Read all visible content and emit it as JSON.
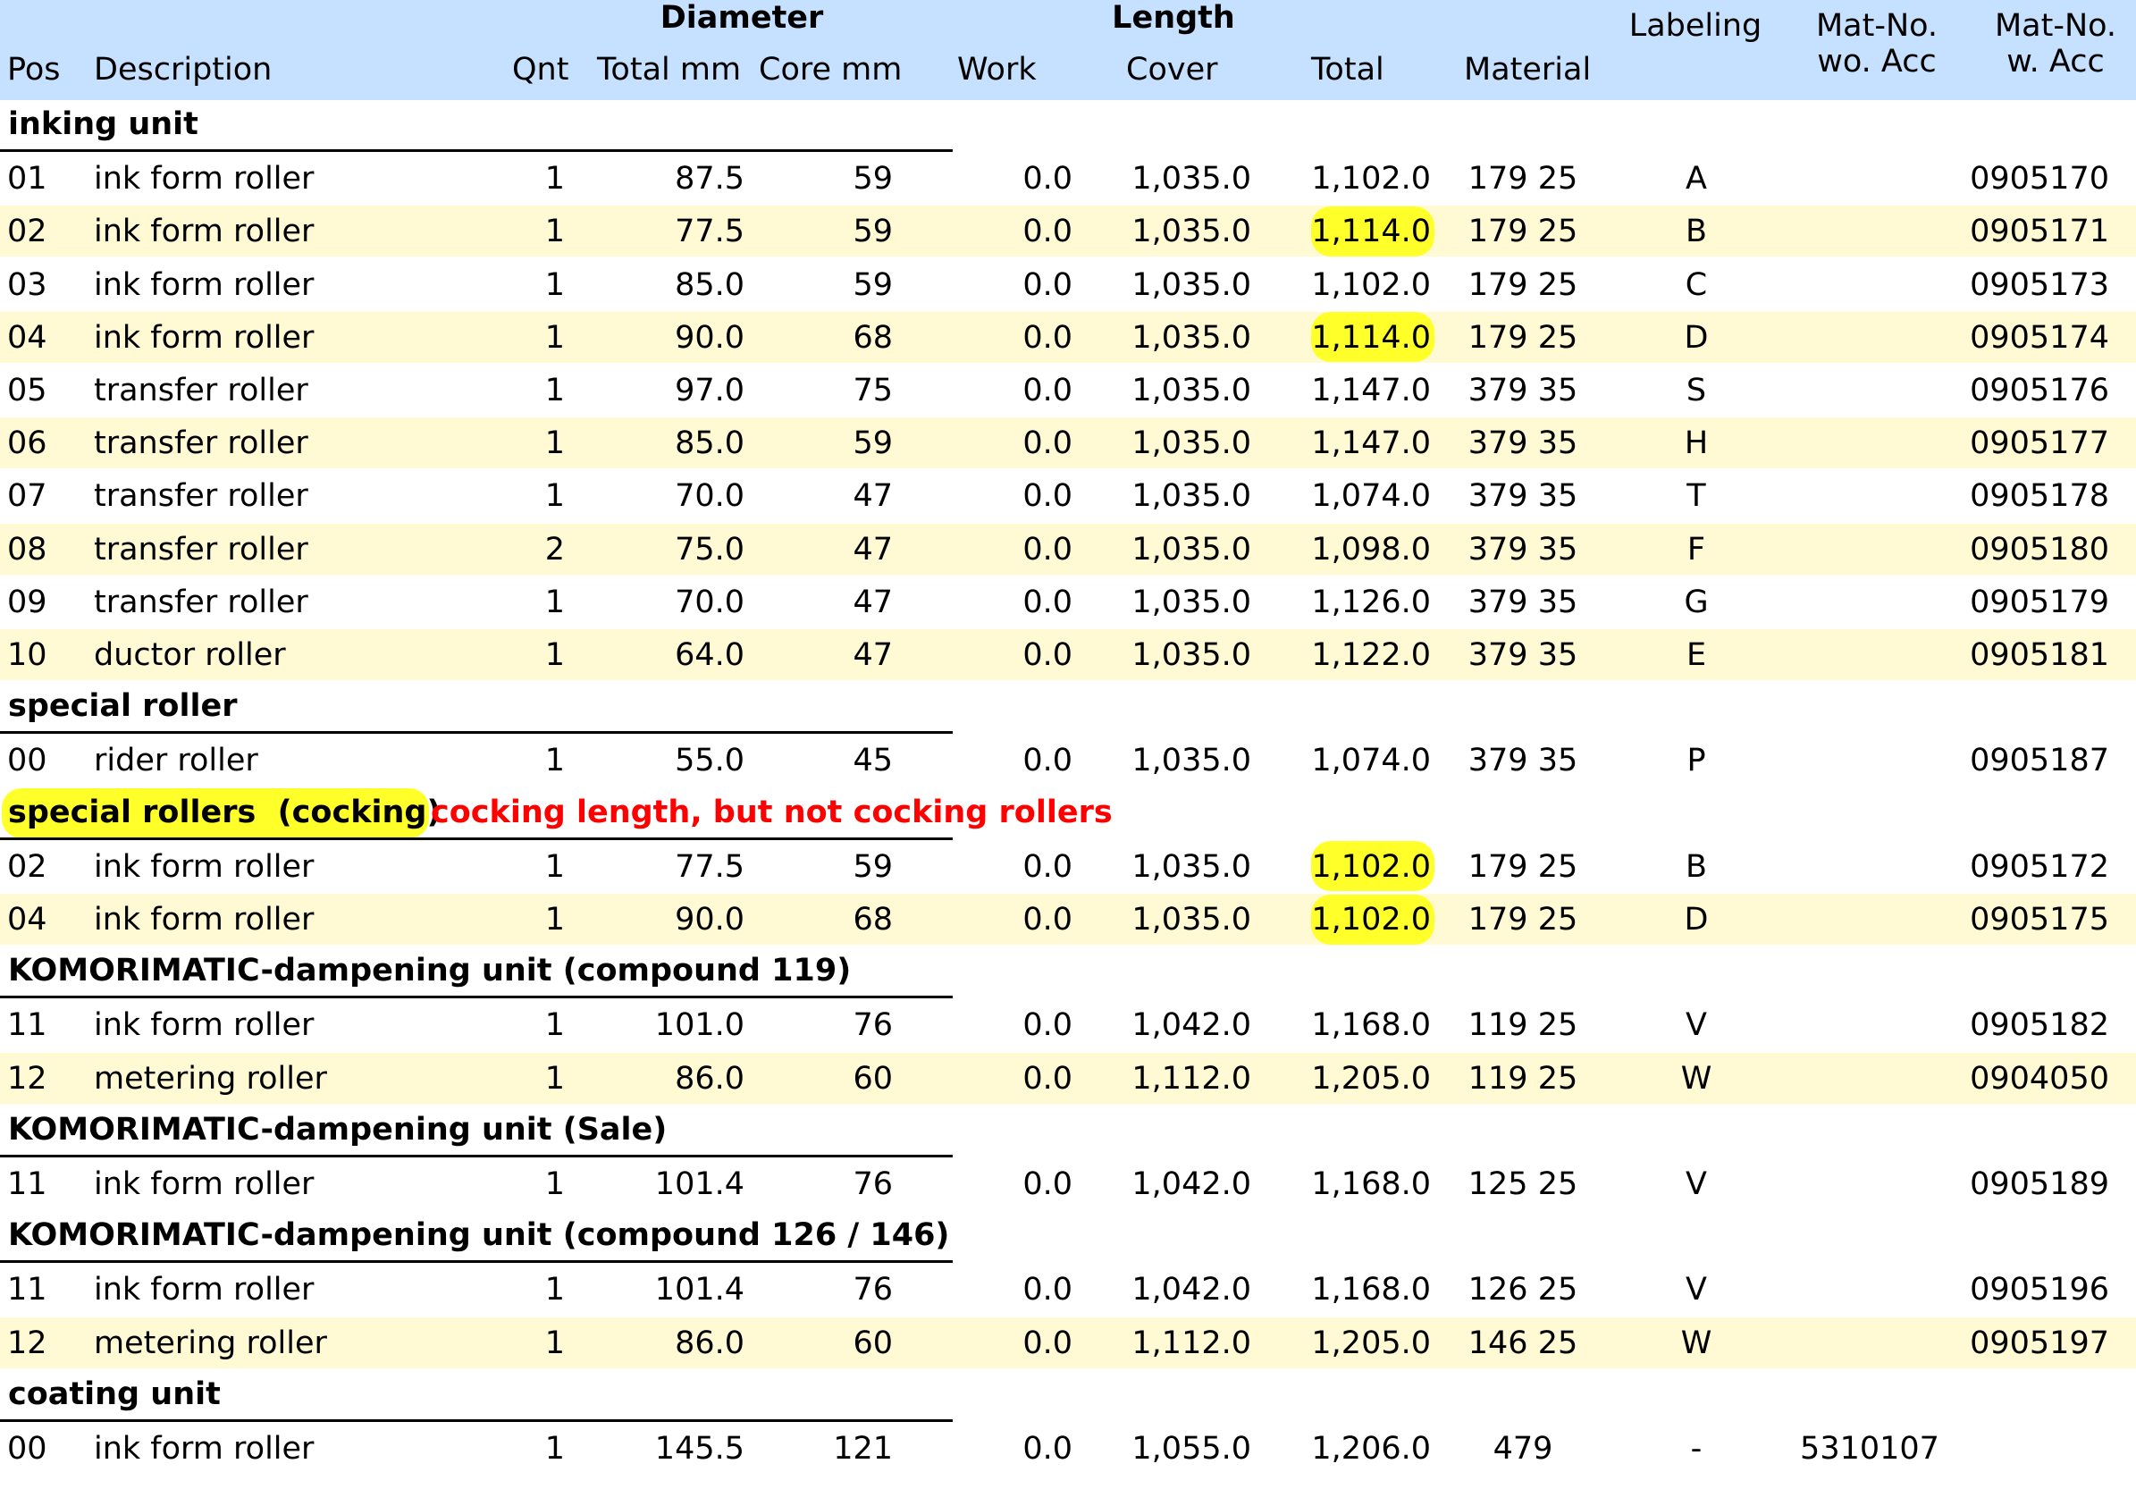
{
  "header": {
    "group_diameter": "Diameter",
    "group_length": "Length",
    "pos": "Pos",
    "description": "Description",
    "qnt": "Qnt",
    "total_mm": "Total mm",
    "core_mm": "Core mm",
    "work": "Work",
    "cover": "Cover",
    "total": "Total",
    "material": "Material",
    "labeling": "Labeling",
    "matno_wo_line1": "Mat-No.",
    "matno_wo_line2": "wo. Acc",
    "matno_w_line1": "Mat-No.",
    "matno_w_line2": "w. Acc"
  },
  "sections": [
    {
      "title": "inking unit",
      "rows": [
        {
          "pos": "01",
          "desc": "ink form roller",
          "qnt": "1",
          "dia_total": "87.5",
          "dia_core": "59",
          "work": "0.0",
          "cover": "1,035.0",
          "total": "1,102.0",
          "material": "179 25",
          "label": "A",
          "matno_wo": "",
          "matno_w": "0905170"
        },
        {
          "pos": "02",
          "desc": "ink form roller",
          "qnt": "1",
          "dia_total": "77.5",
          "dia_core": "59",
          "work": "0.0",
          "cover": "1,035.0",
          "total": "1,114.0",
          "material": "179 25",
          "label": "B",
          "matno_wo": "",
          "matno_w": "0905171"
        },
        {
          "pos": "03",
          "desc": "ink form roller",
          "qnt": "1",
          "dia_total": "85.0",
          "dia_core": "59",
          "work": "0.0",
          "cover": "1,035.0",
          "total": "1,102.0",
          "material": "179 25",
          "label": "C",
          "matno_wo": "",
          "matno_w": "0905173"
        },
        {
          "pos": "04",
          "desc": "ink form roller",
          "qnt": "1",
          "dia_total": "90.0",
          "dia_core": "68",
          "work": "0.0",
          "cover": "1,035.0",
          "total": "1,114.0",
          "material": "179 25",
          "label": "D",
          "matno_wo": "",
          "matno_w": "0905174"
        },
        {
          "pos": "05",
          "desc": "transfer roller",
          "qnt": "1",
          "dia_total": "97.0",
          "dia_core": "75",
          "work": "0.0",
          "cover": "1,035.0",
          "total": "1,147.0",
          "material": "379 35",
          "label": "S",
          "matno_wo": "",
          "matno_w": "0905176"
        },
        {
          "pos": "06",
          "desc": "transfer roller",
          "qnt": "1",
          "dia_total": "85.0",
          "dia_core": "59",
          "work": "0.0",
          "cover": "1,035.0",
          "total": "1,147.0",
          "material": "379 35",
          "label": "H",
          "matno_wo": "",
          "matno_w": "0905177"
        },
        {
          "pos": "07",
          "desc": "transfer roller",
          "qnt": "1",
          "dia_total": "70.0",
          "dia_core": "47",
          "work": "0.0",
          "cover": "1,035.0",
          "total": "1,074.0",
          "material": "379 35",
          "label": "T",
          "matno_wo": "",
          "matno_w": "0905178"
        },
        {
          "pos": "08",
          "desc": "transfer roller",
          "qnt": "2",
          "dia_total": "75.0",
          "dia_core": "47",
          "work": "0.0",
          "cover": "1,035.0",
          "total": "1,098.0",
          "material": "379 35",
          "label": "F",
          "matno_wo": "",
          "matno_w": "0905180"
        },
        {
          "pos": "09",
          "desc": "transfer roller",
          "qnt": "1",
          "dia_total": "70.0",
          "dia_core": "47",
          "work": "0.0",
          "cover": "1,035.0",
          "total": "1,126.0",
          "material": "379 35",
          "label": "G",
          "matno_wo": "",
          "matno_w": "0905179"
        },
        {
          "pos": "10",
          "desc": "ductor roller",
          "qnt": "1",
          "dia_total": "64.0",
          "dia_core": "47",
          "work": "0.0",
          "cover": "1,035.0",
          "total": "1,122.0",
          "material": "379 35",
          "label": "E",
          "matno_wo": "",
          "matno_w": "0905181"
        }
      ]
    },
    {
      "title": "special roller",
      "rows": [
        {
          "pos": "00",
          "desc": "rider roller",
          "qnt": "1",
          "dia_total": "55.0",
          "dia_core": "45",
          "work": "0.0",
          "cover": "1,035.0",
          "total": "1,074.0",
          "material": "379 35",
          "label": "P",
          "matno_wo": "",
          "matno_w": "0905187"
        }
      ]
    },
    {
      "title": "special rollers  (cocking)",
      "note": "cocking length, but not cocking rollers",
      "rows": [
        {
          "pos": "02",
          "desc": "ink form roller",
          "qnt": "1",
          "dia_total": "77.5",
          "dia_core": "59",
          "work": "0.0",
          "cover": "1,035.0",
          "total": "1,102.0",
          "material": "179 25",
          "label": "B",
          "matno_wo": "",
          "matno_w": "0905172"
        },
        {
          "pos": "04",
          "desc": "ink form roller",
          "qnt": "1",
          "dia_total": "90.0",
          "dia_core": "68",
          "work": "0.0",
          "cover": "1,035.0",
          "total": "1,102.0",
          "material": "179 25",
          "label": "D",
          "matno_wo": "",
          "matno_w": "0905175"
        }
      ]
    },
    {
      "title": "KOMORIMATIC-dampening unit (compound 119)",
      "rows": [
        {
          "pos": "11",
          "desc": "ink form roller",
          "qnt": "1",
          "dia_total": "101.0",
          "dia_core": "76",
          "work": "0.0",
          "cover": "1,042.0",
          "total": "1,168.0",
          "material": "119 25",
          "label": "V",
          "matno_wo": "",
          "matno_w": "0905182"
        },
        {
          "pos": "12",
          "desc": "metering roller",
          "qnt": "1",
          "dia_total": "86.0",
          "dia_core": "60",
          "work": "0.0",
          "cover": "1,112.0",
          "total": "1,205.0",
          "material": "119 25",
          "label": "W",
          "matno_wo": "",
          "matno_w": "0904050"
        }
      ]
    },
    {
      "title": "KOMORIMATIC-dampening unit (Sale)",
      "rows": [
        {
          "pos": "11",
          "desc": "ink form roller",
          "qnt": "1",
          "dia_total": "101.4",
          "dia_core": "76",
          "work": "0.0",
          "cover": "1,042.0",
          "total": "1,168.0",
          "material": "125 25",
          "label": "V",
          "matno_wo": "",
          "matno_w": "0905189"
        }
      ]
    },
    {
      "title": "KOMORIMATIC-dampening unit (compound 126 / 146)",
      "rows": [
        {
          "pos": "11",
          "desc": "ink form roller",
          "qnt": "1",
          "dia_total": "101.4",
          "dia_core": "76",
          "work": "0.0",
          "cover": "1,042.0",
          "total": "1,168.0",
          "material": "126 25",
          "label": "V",
          "matno_wo": "",
          "matno_w": "0905196"
        },
        {
          "pos": "12",
          "desc": "metering roller",
          "qnt": "1",
          "dia_total": "86.0",
          "dia_core": "60",
          "work": "0.0",
          "cover": "1,112.0",
          "total": "1,205.0",
          "material": "146 25",
          "label": "W",
          "matno_wo": "",
          "matno_w": "0905197"
        }
      ]
    },
    {
      "title": "coating unit",
      "rows": [
        {
          "pos": "00",
          "desc": "ink form roller",
          "qnt": "1",
          "dia_total": "145.5",
          "dia_core": "121",
          "work": "0.0",
          "cover": "1,055.0",
          "total": "1,206.0",
          "material": "479",
          "label": "-",
          "matno_wo": "5310107",
          "matno_w": ""
        }
      ]
    }
  ],
  "highlight_total_cells": [
    "0.1",
    "0.3",
    "2.0",
    "2.1"
  ],
  "colors": {
    "header_bg": "#c6e0ff",
    "alt_row_bg": "#fff9d4",
    "highlight": "#ffff2a",
    "note_text": "#ff0000"
  }
}
